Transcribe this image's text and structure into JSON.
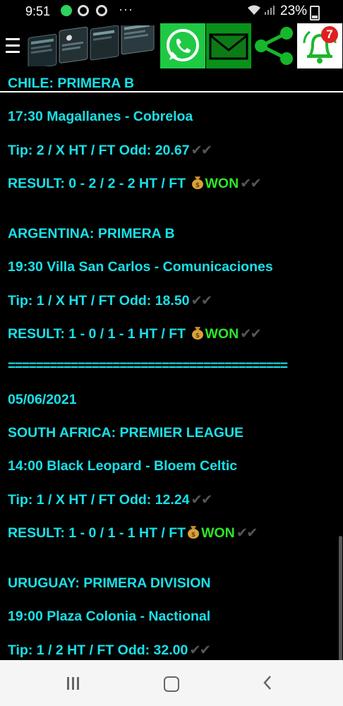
{
  "status_bar": {
    "time": "9:51",
    "battery": "23%",
    "icons": [
      "whatsapp-icon",
      "notification-o-icon",
      "notification-o-icon",
      "more-dots-icon",
      "wifi-icon",
      "signal-icon",
      "battery-icon"
    ]
  },
  "app_bar": {
    "menu_icon": "hamburger-menu-icon",
    "share_buttons": [
      "whatsapp",
      "email",
      "share",
      "notifications"
    ],
    "notification_count": "7",
    "colors": {
      "whatsapp": "#1fc944",
      "email": "#09911b"
    }
  },
  "feed": {
    "separator": "========================================",
    "date": "05/06/2021",
    "matches": [
      {
        "league": "CHILE: PRIMERA B",
        "fixture": "17:30 Magallanes - Cobreloa",
        "tip": "Tip: 2 / X HT / FT Odd: 20.67",
        "result": "RESULT: 0 - 2 / 2 - 2 HT / FT",
        "status": "WON"
      },
      {
        "league": "ARGENTINA: PRIMERA B",
        "fixture": "19:30 Villa San Carlos - Comunicaciones",
        "tip": "Tip: 1 / X HT / FT Odd: 18.50",
        "result": "RESULT: 1 - 0 / 1 - 1 HT / FT",
        "status": "WON"
      },
      {
        "league": "SOUTH AFRICA: PREMIER LEAGUE",
        "fixture": "14:00 Black Leopard - Bloem Celtic",
        "tip": "Tip: 1 / X HT / FT Odd: 12.24",
        "result": "RESULT: 1 - 0 / 1 - 1 HT / FT",
        "status": "WON"
      },
      {
        "league": "URUGUAY: PRIMERA DIVISION",
        "fixture": "19:00 Plaza Colonia - Nactional",
        "tip": "Tip: 1 / 2 HT / FT Odd: 32.00"
      }
    ],
    "colors": {
      "text": "#19e0e8",
      "won": "#2ee628"
    }
  },
  "nav_bar": {
    "buttons": [
      "recents-icon",
      "home-icon",
      "back-icon"
    ]
  }
}
